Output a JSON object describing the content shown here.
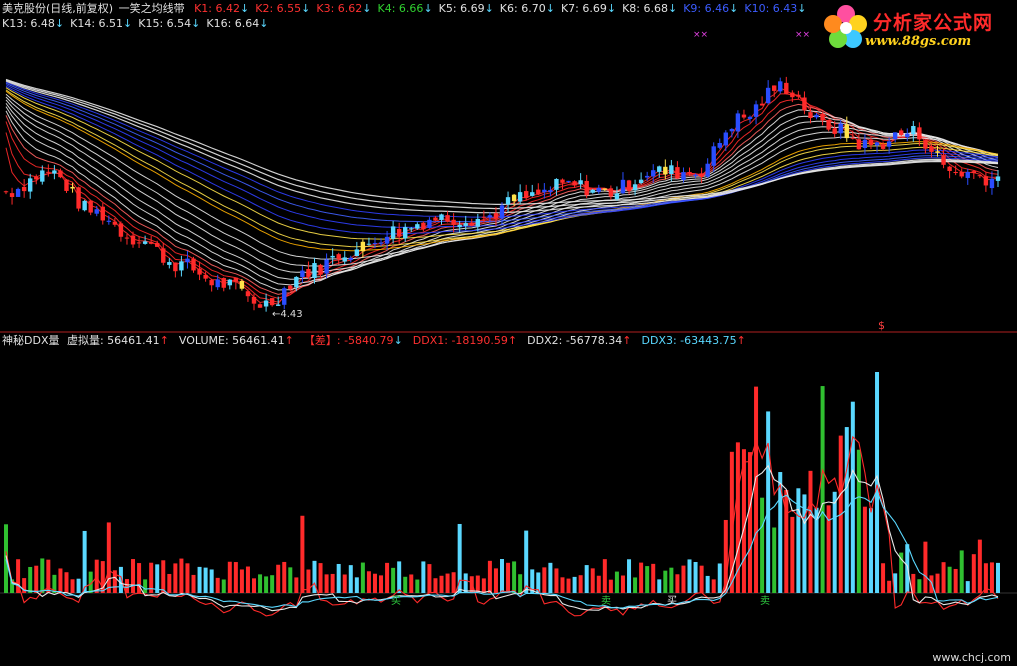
{
  "chart_title": "美克股份(日线,前复权)",
  "indicator_name": "一笑之均线带",
  "ma_values": [
    {
      "label": "K1: 6.42",
      "arrow": "↓",
      "color": "#ff3030"
    },
    {
      "label": "K2: 6.55",
      "arrow": "↓",
      "color": "#ff3030"
    },
    {
      "label": "K3: 6.62",
      "arrow": "↓",
      "color": "#ff3030"
    },
    {
      "label": "K4: 6.66",
      "arrow": "↓",
      "color": "#30d030"
    },
    {
      "label": "K5: 6.69",
      "arrow": "↓",
      "color": "#e0e0e0"
    },
    {
      "label": "K6: 6.70",
      "arrow": "↓",
      "color": "#e0e0e0"
    },
    {
      "label": "K7: 6.69",
      "arrow": "↓",
      "color": "#e0e0e0"
    },
    {
      "label": "K8: 6.68",
      "arrow": "↓",
      "color": "#e0e0e0"
    },
    {
      "label": "K9: 6.46",
      "arrow": "↓",
      "color": "#3c5cff"
    },
    {
      "label": "K10: 6.43",
      "arrow": "↓",
      "color": "#3c5cff"
    }
  ],
  "ma_values_row2": [
    {
      "label": "K13: 6.48",
      "arrow": "↓",
      "color": "#e0e0e0"
    },
    {
      "label": "K14: 6.51",
      "arrow": "↓",
      "color": "#e0e0e0"
    },
    {
      "label": "K15: 6.54",
      "arrow": "↓",
      "color": "#e0e0e0"
    },
    {
      "label": "K16: 6.64",
      "arrow": "↓",
      "color": "#e0e0e0"
    }
  ],
  "low_label": "←4.43",
  "dollar_marker": "$",
  "indicator2": {
    "name": "神秘DDX量",
    "items": [
      {
        "label": "虚拟量: 56461.41",
        "arrow": "↑",
        "color": "#e0e0e0"
      },
      {
        "label": "VOLUME: 56461.41",
        "arrow": "↑",
        "color": "#e0e0e0"
      },
      {
        "label": "【差】: -5840.79",
        "arrow": "↓",
        "color": "#ff3030"
      },
      {
        "label": "DDX1: -18190.59",
        "arrow": "↑",
        "color": "#ff3030"
      },
      {
        "label": "DDX2: -56778.34",
        "arrow": "↑",
        "color": "#e0e0e0"
      },
      {
        "label": "DDX3: -63443.75",
        "arrow": "↑",
        "color": "#5ad8ff"
      }
    ]
  },
  "signals": [
    "买",
    "卖",
    "买",
    "卖"
  ],
  "logo": {
    "title": "分析家公式网",
    "url": "www.88gs.com"
  },
  "watermark": "www.chcj.com",
  "chart_data": {
    "type": "candlestick",
    "price_ylim": [
      4.2,
      8.6
    ],
    "ma_current": {
      "K1": 6.42,
      "K2": 6.55,
      "K3": 6.62,
      "K4": 6.66,
      "K5": 6.69,
      "K6": 6.7,
      "K7": 6.69,
      "K8": 6.68,
      "K9": 6.46,
      "K10": 6.43,
      "K13": 6.48,
      "K14": 6.51,
      "K15": 6.54,
      "K16": 6.64
    },
    "low_price": 4.43,
    "close_trend": [
      6.3,
      6.6,
      6.0,
      5.6,
      5.2,
      4.9,
      4.6,
      5.1,
      5.4,
      5.7,
      5.9,
      5.9,
      6.2,
      6.4,
      6.3,
      6.6,
      6.6,
      7.4,
      7.9,
      7.3,
      7.0,
      7.2,
      6.6,
      6.5
    ],
    "volume_current": 56461.41,
    "ddx": {
      "diff": -5840.79,
      "ddx1": -18190.59,
      "ddx2": -56778.34,
      "ddx3": -63443.75
    }
  },
  "colors": {
    "up": "#ff2a2a",
    "down": "#2a4dff",
    "doji": "#ffe24a",
    "cyan": "#5ad8ff",
    "green": "#30c030",
    "white": "#e8e8e8",
    "blue": "#3040ff",
    "orange": "#ffb000"
  }
}
